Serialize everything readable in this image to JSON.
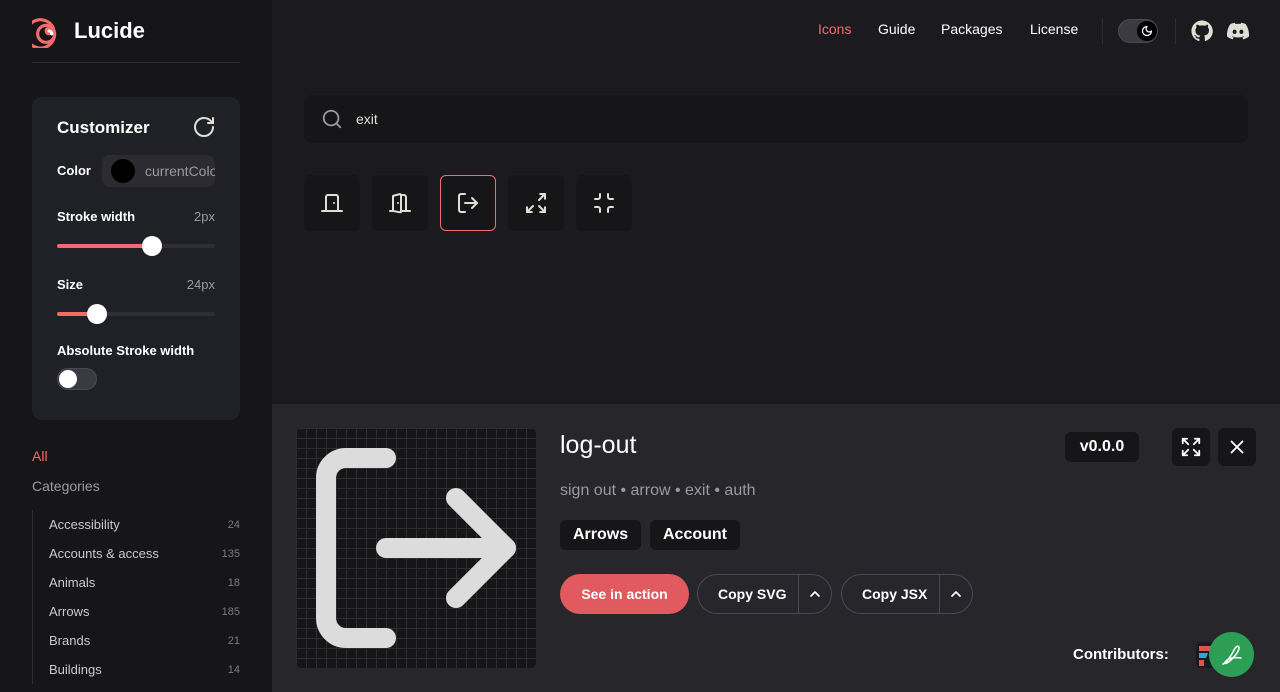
{
  "app": {
    "name": "Lucide"
  },
  "nav": {
    "links": [
      {
        "label": "Icons",
        "active": true
      },
      {
        "label": "Guide",
        "active": false
      },
      {
        "label": "Packages",
        "active": false
      },
      {
        "label": "License",
        "active": false
      }
    ],
    "theme": "dark",
    "icons": [
      "github-icon",
      "discord-icon"
    ]
  },
  "customizer": {
    "title": "Customizer",
    "color": {
      "label": "Color",
      "value": "currentColor",
      "swatch": "#000000"
    },
    "stroke_width": {
      "label": "Stroke width",
      "value": "2px",
      "level": 0.6
    },
    "size": {
      "label": "Size",
      "value": "24px",
      "level": 0.25
    },
    "absolute_stroke": {
      "label": "Absolute Stroke width",
      "enabled": false
    }
  },
  "categories": {
    "all_label": "All",
    "heading": "Categories",
    "items": [
      {
        "name": "Accessibility",
        "count": "24"
      },
      {
        "name": "Accounts & access",
        "count": "135"
      },
      {
        "name": "Animals",
        "count": "18"
      },
      {
        "name": "Arrows",
        "count": "185"
      },
      {
        "name": "Brands",
        "count": "21"
      },
      {
        "name": "Buildings",
        "count": "14"
      }
    ]
  },
  "search": {
    "value": "exit"
  },
  "results": [
    {
      "icon": "door-closed-icon",
      "selected": false
    },
    {
      "icon": "door-open-icon",
      "selected": false
    },
    {
      "icon": "log-out-icon",
      "selected": true
    },
    {
      "icon": "shrink-icon",
      "selected": false
    },
    {
      "icon": "minimize-icon",
      "selected": false
    }
  ],
  "detail": {
    "name": "log-out",
    "tags": "sign out • arrow • exit • auth",
    "categories": [
      "Arrows",
      "Account"
    ],
    "primary_button": "See in action",
    "copy_svg": "Copy SVG",
    "copy_jsx": "Copy JSX",
    "version": "v0.0.0",
    "contributors_label": "Contributors:"
  },
  "colors": {
    "accent": "#f36c6c",
    "primary_button": "#e05a5f"
  }
}
